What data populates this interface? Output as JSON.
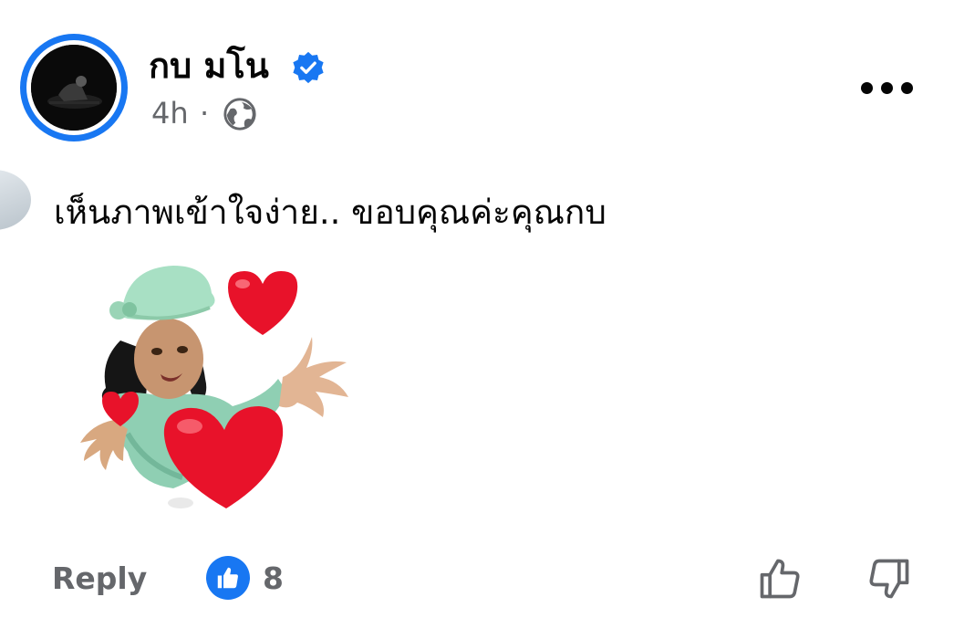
{
  "post": {
    "author_name": "กบ มโน",
    "time": "4h",
    "separator": "·",
    "privacy_icon": "globe-icon",
    "verified_icon": "verified-badge-icon",
    "more_icon": "more-options-icon"
  },
  "comment": {
    "text": "เห็นภาพเข้าใจง่าย.. ขอบคุณค่ะคุณกบ",
    "sticker_icon": "sticker-hearts-girl"
  },
  "actions": {
    "reply_label": "Reply",
    "like_count": "8",
    "like_icon": "like-reaction-icon",
    "upvote_icon": "thumbs-up-icon",
    "downvote_icon": "thumbs-down-icon"
  },
  "colors": {
    "brand_blue": "#1877f2",
    "secondary_text": "#65676b",
    "primary_text": "#050505",
    "heart_red": "#e8122a"
  }
}
